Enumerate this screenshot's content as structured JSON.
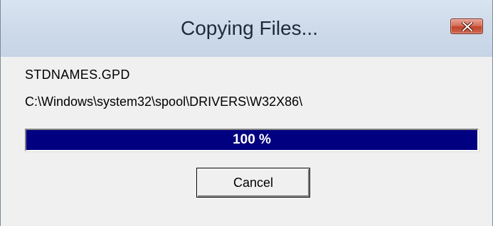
{
  "window": {
    "title": "Copying Files..."
  },
  "titlebar": {
    "close_icon": "close-icon"
  },
  "content": {
    "filename": "STDNAMES.GPD",
    "path": "C:\\Windows\\system32\\spool\\DRIVERS\\W32X86\\"
  },
  "progress": {
    "percent": 100,
    "label": "100 %",
    "fill_color": "#000080",
    "text_color": "#ffffff"
  },
  "buttons": {
    "cancel_label": "Cancel"
  },
  "colors": {
    "close_button": "#c0432b",
    "dialog_background": "#f0f0f0"
  }
}
